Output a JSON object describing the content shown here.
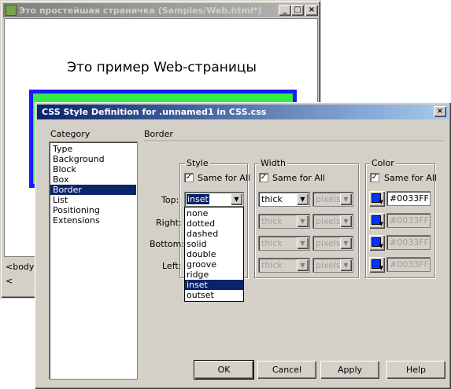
{
  "background_window": {
    "title": "Это простейшая страничка (Samples/Web.html*)",
    "heading": "Это пример Web-страницы",
    "status_tag": "<body> <",
    "colors": {
      "outer_box": "#1a1aff",
      "inner_box": "#33ee44"
    }
  },
  "dialog": {
    "title": "CSS Style Definition for .unnamed1 in CSS.css",
    "category_label": "Category",
    "categories": [
      "Type",
      "Background",
      "Block",
      "Box",
      "Border",
      "List",
      "Positioning",
      "Extensions"
    ],
    "selected_category": "Border",
    "section_title": "Border",
    "groups": {
      "style": {
        "legend": "Style",
        "same_for_all": "Same for All"
      },
      "width": {
        "legend": "Width",
        "same_for_all": "Same for All"
      },
      "color": {
        "legend": "Color",
        "same_for_all": "Same for All"
      }
    },
    "rows": {
      "top": {
        "label": "Top:",
        "style": "inset",
        "width": "thick",
        "unit": "pixels",
        "color": "#0033FF"
      },
      "right": {
        "label": "Right:",
        "width": "thick",
        "unit": "pixels",
        "color": "#0033FF"
      },
      "bottom": {
        "label": "Bottom:",
        "width": "thick",
        "unit": "pixels",
        "color": "#0033FF"
      },
      "left": {
        "label": "Left:",
        "width": "thick",
        "unit": "pixels",
        "color": "#0033FF"
      }
    },
    "style_options": [
      "none",
      "dotted",
      "dashed",
      "solid",
      "double",
      "groove",
      "ridge",
      "inset",
      "outset"
    ],
    "selected_style_option": "inset",
    "buttons": {
      "ok": "OK",
      "cancel": "Cancel",
      "apply": "Apply",
      "help": "Help"
    },
    "swatch_color": "#0033FF"
  },
  "icons": {
    "close": "×",
    "minimize": "_",
    "maximize": "□",
    "dropdown": "▼",
    "check": "✓"
  }
}
